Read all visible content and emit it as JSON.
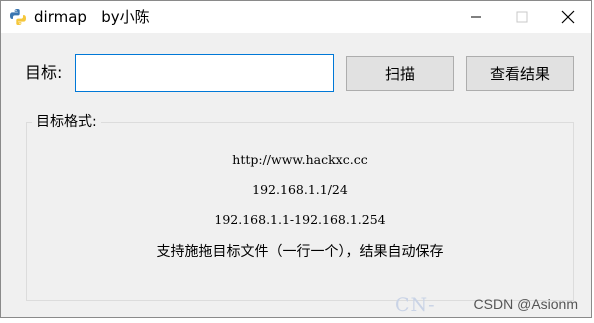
{
  "window": {
    "title": "dirmap   by小陈"
  },
  "form": {
    "target_label": "目标:",
    "target_value": "",
    "scan_button": "扫描",
    "results_button": "查看结果"
  },
  "format_group": {
    "legend": "目标格式:",
    "lines": [
      "http://www.hackxc.cc",
      "192.168.1.1/24",
      "192.168.1.1-192.168.1.254",
      "支持施拖目标文件（一行一个），结果自动保存"
    ]
  },
  "watermark": {
    "text": "CSDN @Asionm",
    "ghost": "CN-"
  },
  "icons": {
    "app": "python-icon",
    "minimize": "minimize-icon",
    "maximize": "maximize-icon",
    "close": "close-icon"
  }
}
